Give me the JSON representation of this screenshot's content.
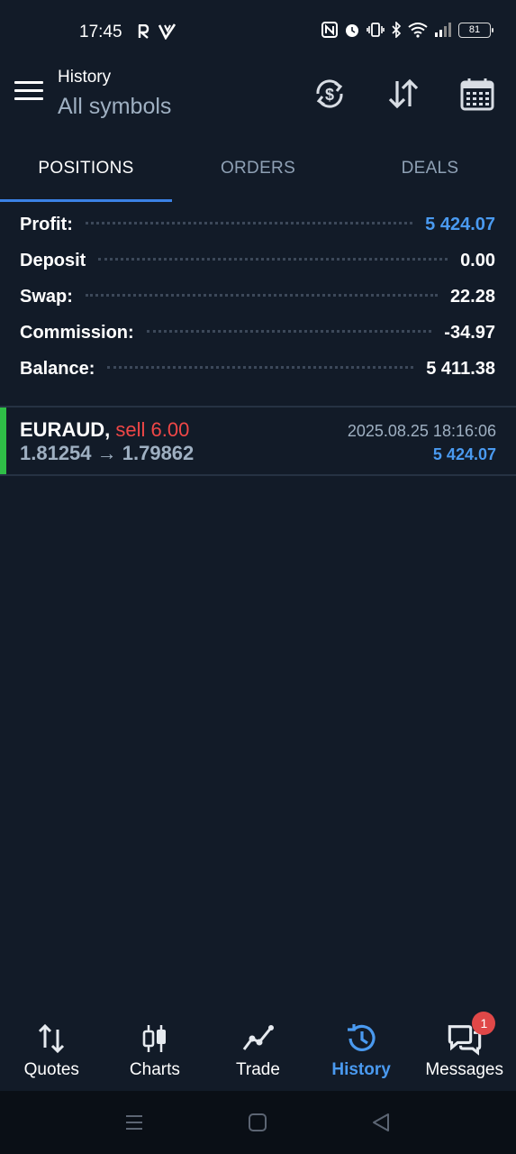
{
  "status_bar": {
    "time": "17:45",
    "battery": "81",
    "icons": [
      "r-app-icon",
      "v-app-icon",
      "nfc-icon",
      "alarm-icon",
      "vibrate-icon",
      "bluetooth-icon",
      "wifi-icon",
      "signal-icon"
    ]
  },
  "header": {
    "subtitle": "History",
    "title": "All symbols",
    "actions": [
      "currency-refresh-icon",
      "sort-icon",
      "calendar-icon"
    ]
  },
  "tabs": [
    {
      "label": "POSITIONS",
      "active": true
    },
    {
      "label": "ORDERS",
      "active": false
    },
    {
      "label": "DEALS",
      "active": false
    }
  ],
  "summary": [
    {
      "label": "Profit:",
      "value": "5 424.07"
    },
    {
      "label": "Deposit",
      "value": "0.00"
    },
    {
      "label": "Swap:",
      "value": "22.28"
    },
    {
      "label": "Commission:",
      "value": "-34.97"
    },
    {
      "label": "Balance:",
      "value": "5 411.38"
    }
  ],
  "positions": [
    {
      "symbol": "EURAUD,",
      "side": "sell 6.00",
      "prices": "1.81254 → 1.79862",
      "time": "2025.08.25 18:16:06",
      "profit": "5 424.07"
    }
  ],
  "bottom_nav": [
    {
      "label": "Quotes",
      "icon": "quotes-icon",
      "active": false
    },
    {
      "label": "Charts",
      "icon": "charts-icon",
      "active": false
    },
    {
      "label": "Trade",
      "icon": "trade-icon",
      "active": false
    },
    {
      "label": "History",
      "icon": "history-icon",
      "active": true
    },
    {
      "label": "Messages",
      "icon": "messages-icon",
      "active": false,
      "badge": "1"
    }
  ],
  "colors": {
    "background": "#121b28",
    "accent": "#4a9af0",
    "sell": "#f04747",
    "position_bar": "#2fbe47"
  }
}
